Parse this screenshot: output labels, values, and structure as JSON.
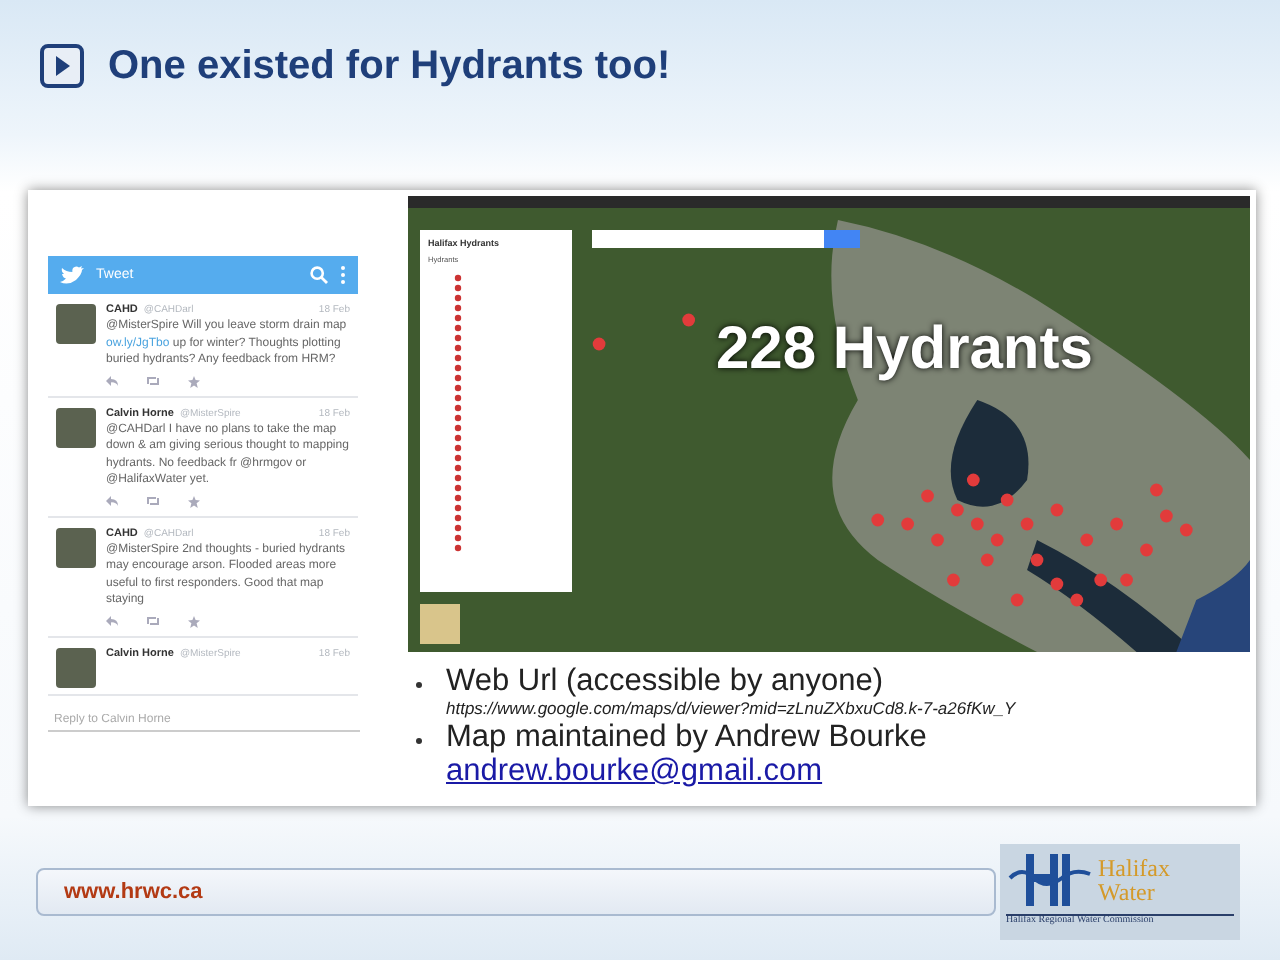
{
  "slide": {
    "title": "One existed for Hydrants too!"
  },
  "twitter": {
    "header": "Tweet",
    "reply_placeholder": "Reply to Calvin Horne",
    "tweets": [
      {
        "author": "CAHD",
        "handle": "@CAHDarl",
        "date": "18 Feb",
        "parts": [
          {
            "kind": "plain",
            "text": "@MisterSpire Will you leave storm drain map "
          },
          {
            "kind": "link",
            "text": "ow.ly/JgTbo"
          },
          {
            "kind": "plain",
            "text": " up for winter? Thoughts plotting buried hydrants? Any feedback from HRM?"
          }
        ]
      },
      {
        "author": "Calvin Horne",
        "handle": "@MisterSpire",
        "date": "18 Feb",
        "parts": [
          {
            "kind": "plain",
            "text": "@CAHDarl I have no plans to take the map down & am giving serious thought to mapping hydrants. No feedback fr @hrmgov or @HalifaxWater yet."
          }
        ]
      },
      {
        "author": "CAHD",
        "handle": "@CAHDarl",
        "date": "18 Feb",
        "parts": [
          {
            "kind": "plain",
            "text": "@MisterSpire 2nd thoughts - buried hydrants may encourage arson. Flooded areas more useful to first responders. Good that map staying"
          }
        ]
      },
      {
        "author": "Calvin Horne",
        "handle": "@MisterSpire",
        "date": "18 Feb"
      }
    ]
  },
  "map": {
    "panel_title": "Halifax Hydrants",
    "layer": "Hydrants",
    "overlay": "228 Hydrants"
  },
  "bullets": [
    {
      "text": "Web Url (accessible by anyone)",
      "url": "https://www.google.com/maps/d/viewer?mid=zLnuZXbxuCd8.k-7-a26fKw_Y"
    },
    {
      "text": "Map maintained by Andrew Bourke",
      "email": "andrew.bourke@gmail.com"
    }
  ],
  "footer": {
    "url": "www.hrwc.ca",
    "logo_name": "Halifax Water",
    "logo_sub": "Halifax Regional Water Commission"
  }
}
